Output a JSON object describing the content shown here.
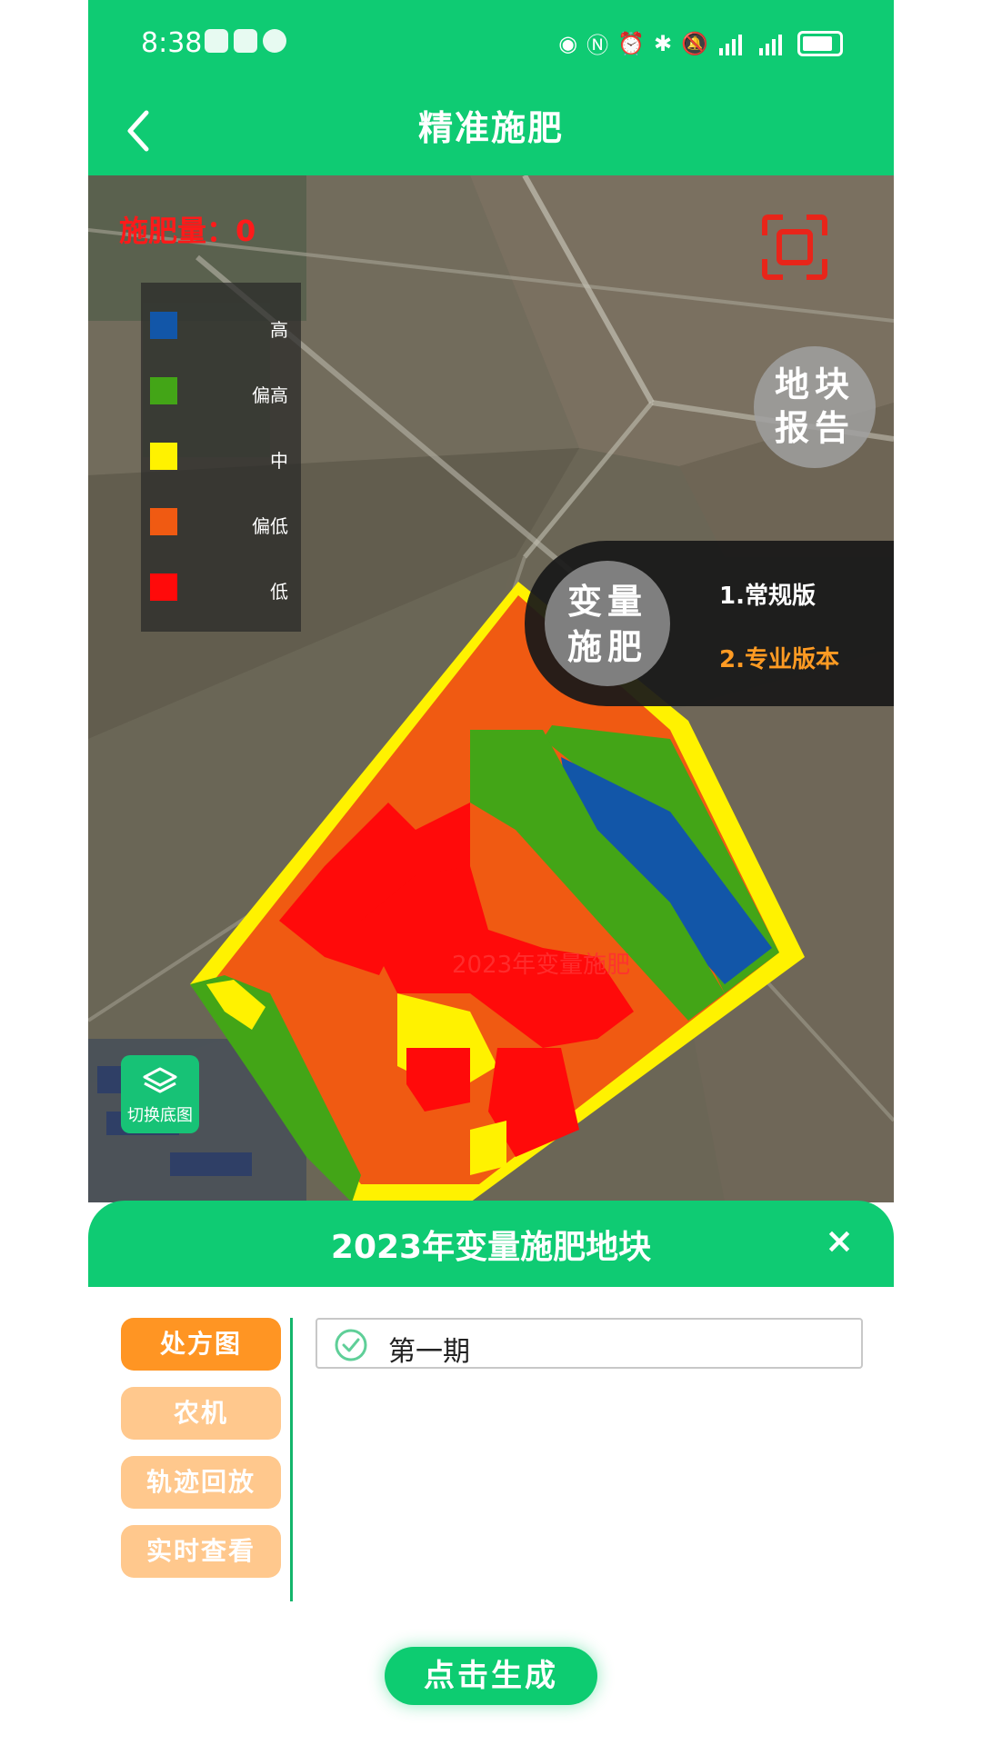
{
  "status_bar": {
    "time": "8:38"
  },
  "header": {
    "title": "精准施肥",
    "back_icon": "chevron-left-icon"
  },
  "map": {
    "fertilizer_amount_label": "施肥量：0",
    "legend": [
      {
        "label": "高",
        "color": "#1256a8"
      },
      {
        "label": "偏高",
        "color": "#43a517"
      },
      {
        "label": "中",
        "color": "#fff200"
      },
      {
        "label": "偏低",
        "color": "#f05a12"
      },
      {
        "label": "低",
        "color": "#ff0a0a"
      }
    ],
    "report_button": {
      "line1": "地块",
      "line2": "报告"
    },
    "variable_menu": {
      "circle_line1": "变量",
      "circle_line2": "施肥",
      "option1": "1.常规版",
      "option2": "2.专业版本"
    },
    "field_label": "2023年变量施肥",
    "switch_basemap_label": "切换底图"
  },
  "sheet": {
    "title": "2023年变量施肥地块",
    "close_label": "×",
    "tabs": [
      {
        "label": "处方图",
        "active": true
      },
      {
        "label": "农机",
        "active": false
      },
      {
        "label": "轨迹回放",
        "active": false
      },
      {
        "label": "实时查看",
        "active": false
      }
    ],
    "period_item": "第一期",
    "generate_label": "点击生成"
  }
}
